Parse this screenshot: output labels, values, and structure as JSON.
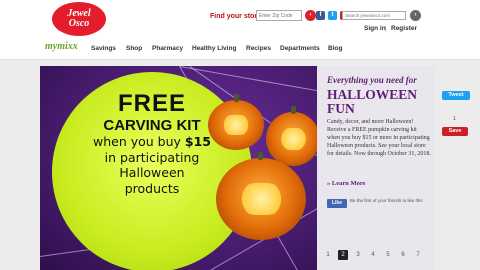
{
  "header": {
    "logo_line1": "Jewel",
    "logo_line2": "Osco",
    "store_label": "Find your store:",
    "zip_placeholder": "Enter Zip Code",
    "go_label": "›",
    "search_placeholder": "Search jewelosco.com",
    "signin": "Sign in",
    "separator": "|",
    "register": "Register",
    "social": [
      {
        "name": "facebook-icon",
        "glyph": "f",
        "color": "#3b5998"
      },
      {
        "name": "twitter-icon",
        "glyph": "t",
        "color": "#1da1f2"
      },
      {
        "name": "pinterest-icon",
        "glyph": "p",
        "color": "#cb2027"
      },
      {
        "name": "youtube-icon",
        "glyph": "▶",
        "color": "#e52d27"
      },
      {
        "name": "instagram-icon",
        "glyph": "◎",
        "color": "#8a3ab9"
      },
      {
        "name": "rss-icon",
        "glyph": "≈",
        "color": "#f26522"
      }
    ]
  },
  "nav": {
    "brand": "mymixx",
    "items": [
      "Savings",
      "Shop",
      "Pharmacy",
      "Healthy Living",
      "Recipes",
      "Departments",
      "Blog"
    ]
  },
  "banner": {
    "line1": "FREE",
    "line2": "CARVING KIT",
    "line3_pre": "when you buy ",
    "line3_amount": "$15",
    "line4": "in participating",
    "line5": "Halloween",
    "line6": "products"
  },
  "side": {
    "tagline": "Everything you need for",
    "title": "HALLOWEEN FUN",
    "body": "Candy, decor, and more Halloween! Receive a FREE pumpkin carving kit when you buy $15 or more in participating Halloween products. See your local store for details. Now through October 31, 2018.",
    "learn_more": "» Learn More",
    "fb_like": "Like",
    "fb_text": "Be the first of your friends to like this",
    "pager": [
      "1",
      "2",
      "3",
      "4",
      "5",
      "6",
      "7"
    ],
    "pager_active_index": 1
  },
  "share": {
    "tweet": "Tweet",
    "count": "1",
    "save": "Save"
  },
  "colors": {
    "brand_red": "#e31d2b",
    "halloween_purple": "#5e1f73",
    "banner_green": "#c9ec20"
  }
}
